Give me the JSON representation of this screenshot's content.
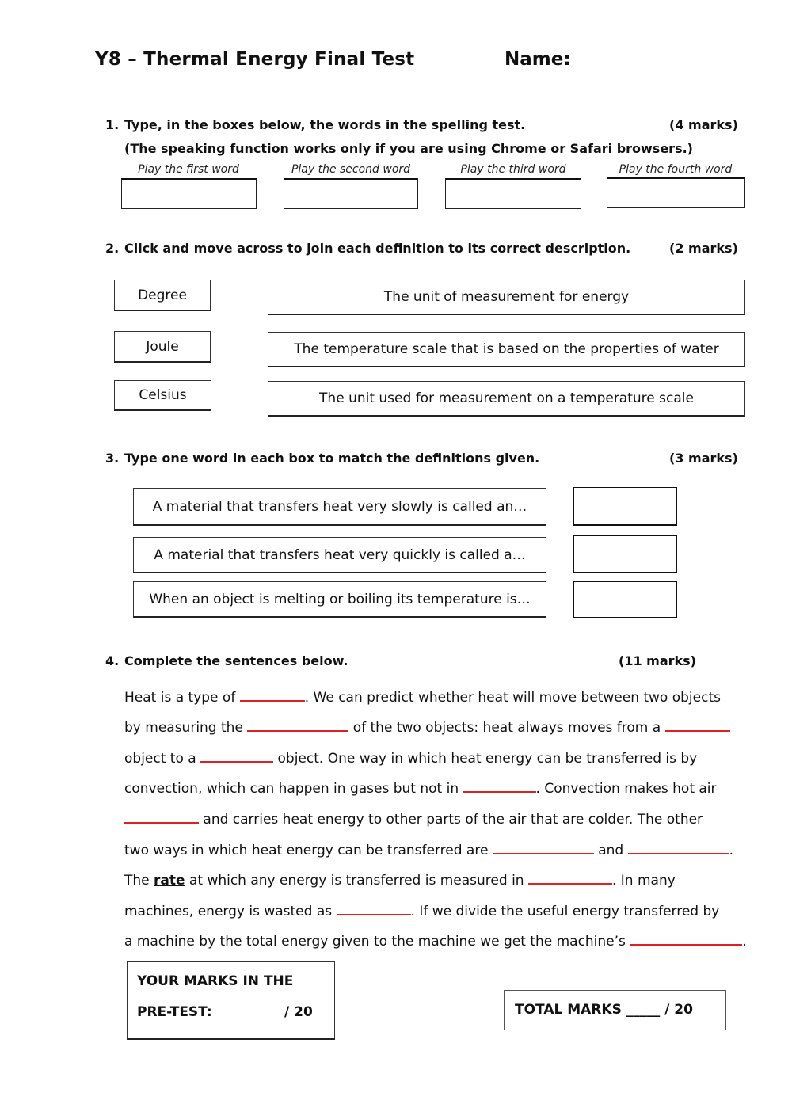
{
  "header": {
    "title": "Y8 – Thermal Energy Final Test",
    "name_label": "Name:"
  },
  "q1": {
    "number": "1.",
    "instruction": "Type, in the boxes below, the words in the spelling test.",
    "marks": "(4 marks)",
    "note": "(The speaking function works only if you are using Chrome or Safari browsers.)",
    "play_buttons": [
      "Play the first word",
      "Play the second word",
      "Play the third word",
      "Play the fourth word"
    ],
    "answers": [
      "",
      "",
      "",
      ""
    ]
  },
  "q2": {
    "number": "2.",
    "instruction": "Click and move across to join each definition to its correct description.",
    "marks": "(2 marks)",
    "terms": [
      "Degree",
      "Joule",
      "Celsius"
    ],
    "descriptions": [
      "The unit of measurement for energy",
      "The temperature scale that is based on the properties of water",
      "The unit used for measurement on a temperature scale"
    ]
  },
  "q3": {
    "number": "3.",
    "instruction": "Type one word in each box to match the definitions given.",
    "marks": "(3 marks)",
    "definitions": [
      "A material that transfers heat very slowly is called an…",
      "A material that transfers heat very quickly is called a…",
      "When an object is melting or boiling its temperature is…"
    ],
    "answers": [
      "",
      "",
      ""
    ]
  },
  "q4": {
    "number": "4.",
    "instruction": "Complete the sentences below.",
    "marks": "(11 marks)",
    "lines": {
      "l1a": "Heat is a type of ",
      "l1b": ". We can predict whether heat will move between two objects",
      "l2a": "by measuring the ",
      "l2b": " of the two objects: heat always moves from a ",
      "l3a": "object to a ",
      "l3b": " object. One way in which heat energy can be transferred is by",
      "l4a": "convection, which can happen in gases but not in ",
      "l4b": ". Convection makes hot air",
      "l5b": " and carries heat energy to other parts of the air that are colder. The other",
      "l6a": "two ways in which heat energy can be transferred are ",
      "l6b": " and ",
      "l6c": ".",
      "l7a": "The ",
      "l7rate": "rate",
      "l7b": " at which any energy is transferred is measured in ",
      "l7c": ". In many",
      "l8a": "machines, energy is wasted as ",
      "l8b": ". If we divide the useful energy transferred by",
      "l9a": "a machine by the total energy given to the machine we get the machine’s ",
      "l9b": "."
    },
    "blank_color": "#e02020"
  },
  "scores": {
    "pretest_line1": "YOUR MARKS IN THE",
    "pretest_label": "PRE-TEST:",
    "pretest_total": "/ 20",
    "total_label": "TOTAL MARKS _____ / 20"
  }
}
